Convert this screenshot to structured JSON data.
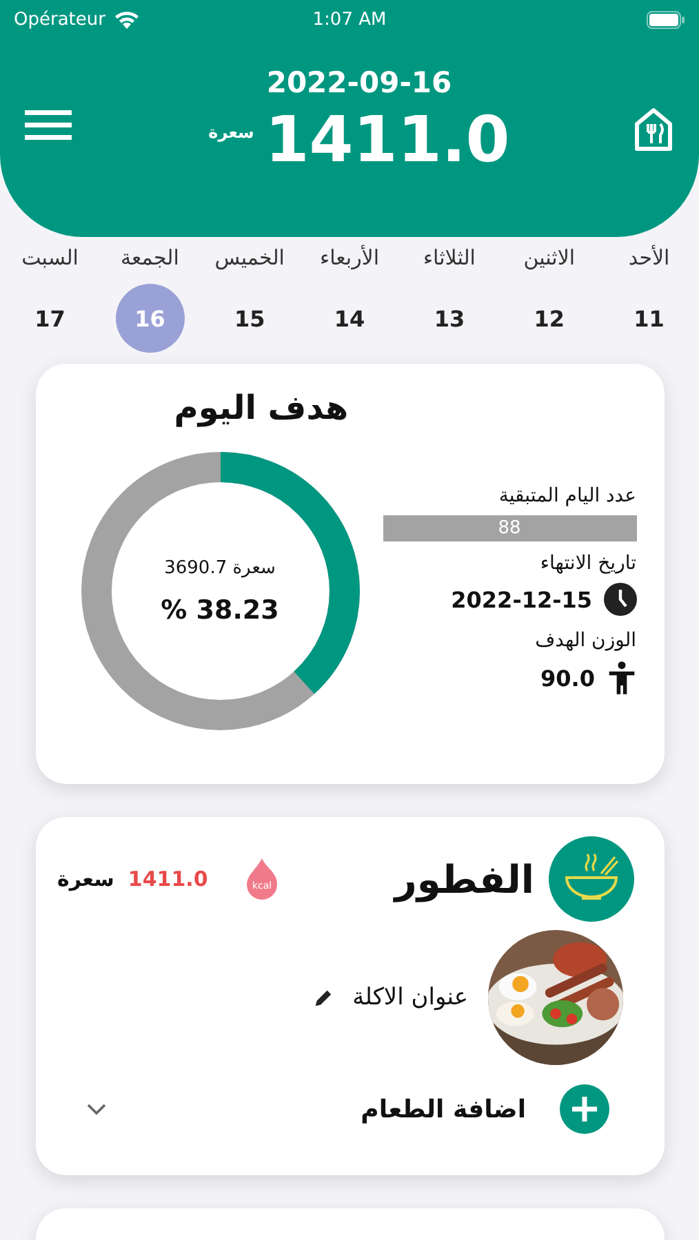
{
  "status_bar": {
    "carrier": "Opérateur",
    "time": "1:07 AM"
  },
  "header": {
    "date": "2022-09-16",
    "calories": "1411.0",
    "unit": "سعرة"
  },
  "days": [
    {
      "name": "الأحد",
      "date": "11",
      "selected": false
    },
    {
      "name": "الاثنين",
      "date": "12",
      "selected": false
    },
    {
      "name": "الثلاثاء",
      "date": "13",
      "selected": false
    },
    {
      "name": "الأربعاء",
      "date": "14",
      "selected": false
    },
    {
      "name": "الخميس",
      "date": "15",
      "selected": false
    },
    {
      "name": "الجمعة",
      "date": "16",
      "selected": true
    },
    {
      "name": "السبت",
      "date": "17",
      "selected": false
    }
  ],
  "goal": {
    "title": "هدف اليوم",
    "level": 0.3823,
    "calories": "3690.7 سعرة",
    "percent": "% 38.23",
    "remaining_label": "عدد اليام المتبقية",
    "remaining_value": "88",
    "end_label": "تاريخ الانتهاء",
    "end_date": "2022-12-15",
    "weight_label": "الوزن الهدف",
    "weight_value": "90.0"
  },
  "meal": {
    "title": "الفطور",
    "calorie_icon_text": "kcal",
    "calories": "1411.0",
    "unit": "سعرة",
    "item_title": "عنوان الاكلة",
    "add_label": "اضافة الطعام",
    "expanded": false
  }
}
